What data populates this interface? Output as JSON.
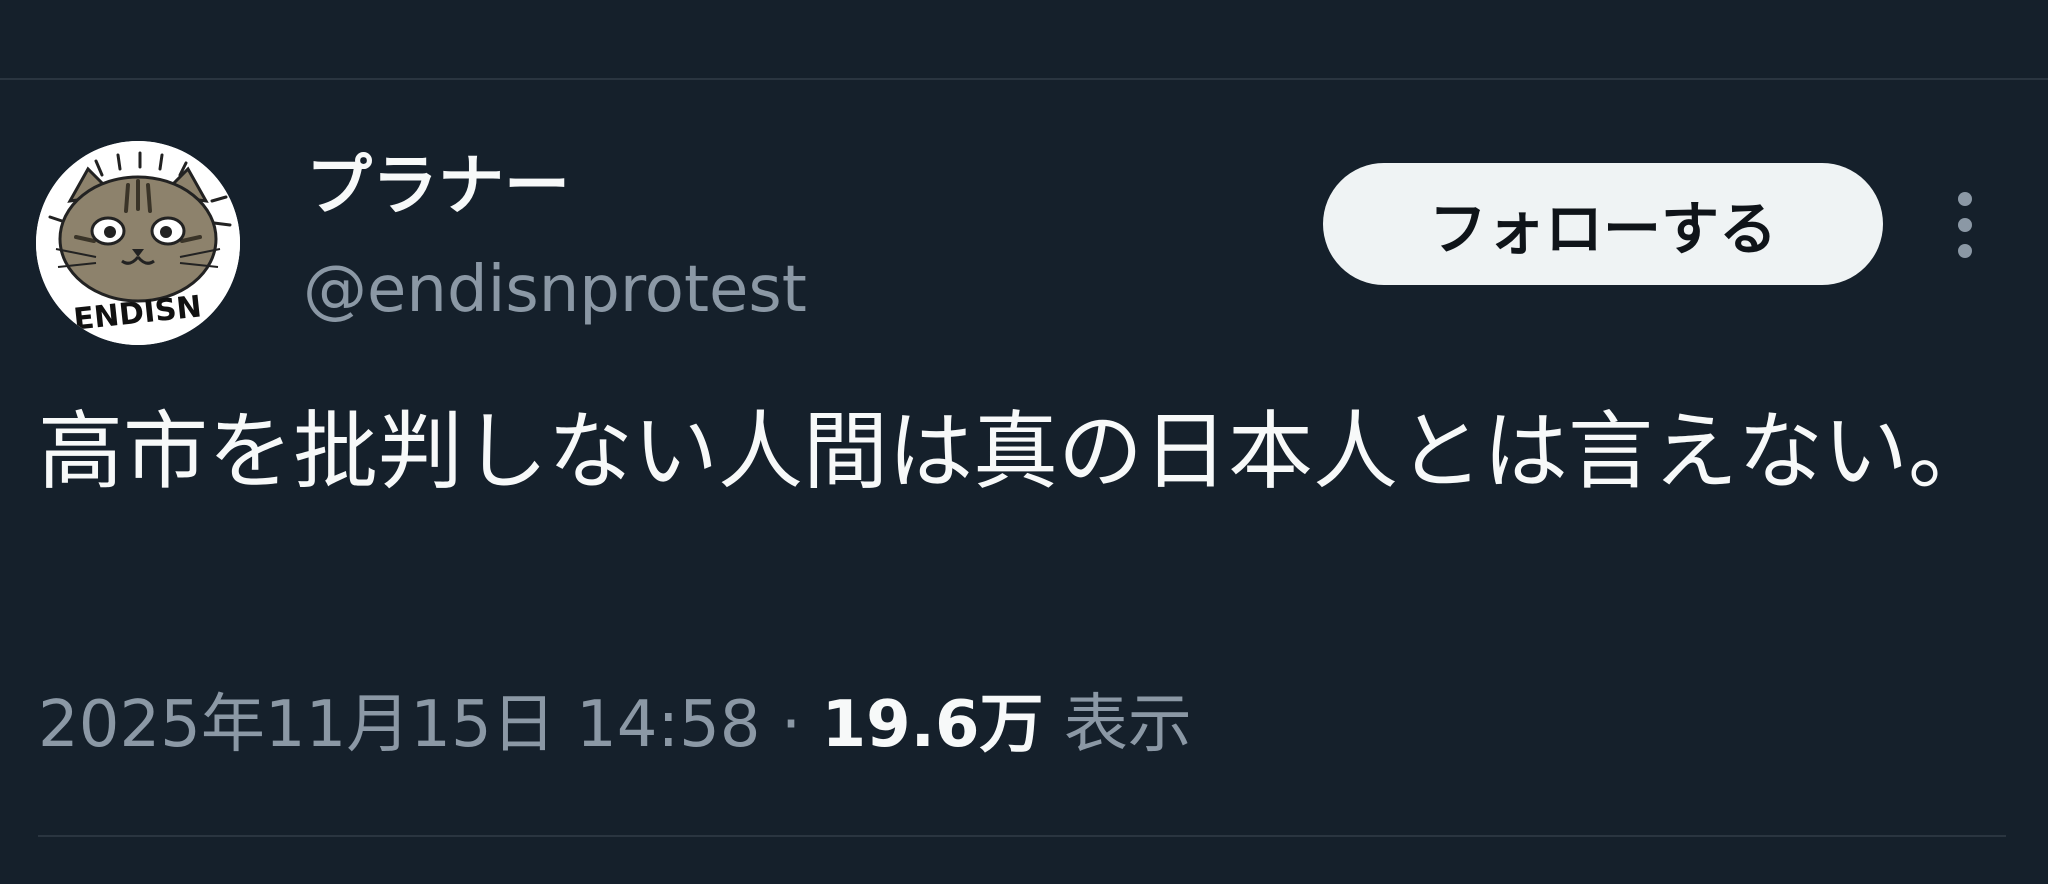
{
  "author": {
    "display_name": "プラナー",
    "handle": "@endisnprotest",
    "avatar_text": "ENDISN"
  },
  "follow_button": {
    "label": "フォローする"
  },
  "more_icon": "more-vertical-icon",
  "tweet": {
    "text": "高市を批判しない人間は真の日本人とは言えない。"
  },
  "meta": {
    "date_time": "2025年11月15日 14:58",
    "separator": " · ",
    "views_count": "19.6万",
    "views_label": " 表示"
  },
  "colors": {
    "background": "#15202b",
    "primary_text": "#f7f9f9",
    "secondary_text": "#8b98a5",
    "divider": "#2a3540",
    "button_bg": "#eff3f4",
    "button_text": "#0f1419"
  }
}
